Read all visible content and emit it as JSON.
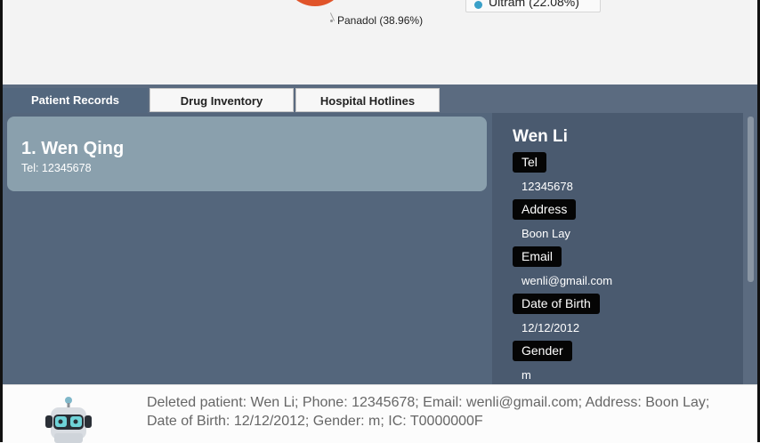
{
  "chart": {
    "pie_label": "Panadol (38.96%)",
    "legend_label": "Ultram (22.08%)",
    "colors": {
      "panadol_slice": "#e0542a",
      "ultram_dot": "#3aa0c8"
    }
  },
  "tabs": [
    {
      "label": "Patient Records",
      "active": true
    },
    {
      "label": "Drug Inventory",
      "active": false
    },
    {
      "label": "Hospital Hotlines",
      "active": false
    }
  ],
  "patient_list": [
    {
      "index_name": "1.  Wen Qing",
      "tel": "Tel: 12345678"
    }
  ],
  "detail": {
    "name": "Wen Li",
    "fields": [
      {
        "label": "Tel",
        "value": "12345678"
      },
      {
        "label": "Address",
        "value": "Boon Lay"
      },
      {
        "label": "Email",
        "value": "wenli@gmail.com"
      },
      {
        "label": "Date of Birth",
        "value": "12/12/2012"
      },
      {
        "label": "Gender",
        "value": "m"
      }
    ]
  },
  "status": {
    "message": "Deleted patient: Wen Li; Phone: 12345678; Email: wenli@gmail.com; Address: Boon Lay; Date of Birth: 12/12/2012; Gender: m; IC: T0000000F"
  },
  "theme": {
    "panel_bg": "#54667c",
    "card_bg": "#8aa0ad",
    "detail_bg": "#4a5a6f",
    "label_bg": "#050505"
  }
}
